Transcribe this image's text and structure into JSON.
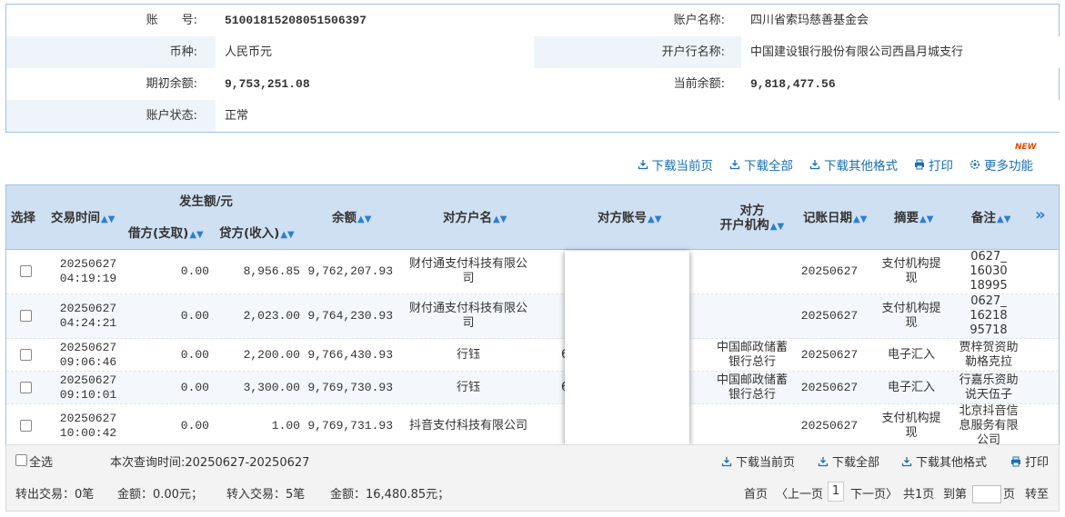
{
  "account": {
    "account_no_label": "账　　号:",
    "account_no": "51001815208051506397",
    "account_name_label": "账户名称:",
    "account_name": "四川省索玛慈善基金会",
    "currency_label": "币种:",
    "currency": "人民币元",
    "bank_label": "开户行名称:",
    "bank": "中国建设银行股份有限公司西昌月城支行",
    "opening_balance_label": "期初余额:",
    "opening_balance": "9,753,251.08",
    "current_balance_label": "当前余额:",
    "current_balance": "9,818,477.56",
    "status_label": "账户状态:",
    "status": "正常"
  },
  "toolbar": {
    "download_page": "下载当前页",
    "download_all": "下载全部",
    "download_other": "下载其他格式",
    "print": "打印",
    "more": "更多功能",
    "new_badge": "NEW"
  },
  "table": {
    "headers": {
      "select": "选择",
      "time": "交易时间",
      "amount_group": "发生额/元",
      "debit": "借方(支取)",
      "credit": "贷方(收入)",
      "balance": "余额",
      "counterparty_name": "对方户名",
      "counterparty_account": "对方账号",
      "counterparty_bank_1": "对方",
      "counterparty_bank_2": "开户机构",
      "post_date": "记账日期",
      "summary": "摘要",
      "remark": "备注",
      "more_cols": "»"
    },
    "rows": [
      {
        "date": "20250627",
        "time": "04:19:19",
        "debit": "0.00",
        "credit": "8,956.85",
        "balance": "9,762,207.93",
        "name_1": "财付通支付科技有限公",
        "name_2": "司",
        "acct": "",
        "bank_1": "",
        "bank_2": "",
        "post": "20250627",
        "summary_1": "支付机构提",
        "summary_2": "现",
        "remark_1": "0627_",
        "remark_2": "16030",
        "remark_3": "18995"
      },
      {
        "date": "20250627",
        "time": "04:24:21",
        "debit": "0.00",
        "credit": "2,023.00",
        "balance": "9,764,230.93",
        "name_1": "财付通支付科技有限公",
        "name_2": "司",
        "acct": "",
        "bank_1": "",
        "bank_2": "",
        "post": "20250627",
        "summary_1": "支付机构提",
        "summary_2": "现",
        "remark_1": "0627_",
        "remark_2": "16218",
        "remark_3": "95718"
      },
      {
        "date": "20250627",
        "time": "09:06:46",
        "debit": "0.00",
        "credit": "2,200.00",
        "balance": "9,766,430.93",
        "name_1": "行钰",
        "name_2": "",
        "acct": "6",
        "bank_1": "中国邮政储蓄",
        "bank_2": "银行总行",
        "post": "20250627",
        "summary_1": "电子汇入",
        "summary_2": "",
        "remark_1": "贾梓贺资助",
        "remark_2": "勒格克拉",
        "remark_3": ""
      },
      {
        "date": "20250627",
        "time": "09:10:01",
        "debit": "0.00",
        "credit": "3,300.00",
        "balance": "9,769,730.93",
        "name_1": "行钰",
        "name_2": "",
        "acct": "6",
        "bank_1": "中国邮政储蓄",
        "bank_2": "银行总行",
        "post": "20250627",
        "summary_1": "电子汇入",
        "summary_2": "",
        "remark_1": "行嘉乐资助",
        "remark_2": "说天伍子",
        "remark_3": ""
      },
      {
        "date": "20250627",
        "time": "10:00:42",
        "debit": "0.00",
        "credit": "1.00",
        "balance": "9,769,731.93",
        "name_1": "抖音支付科技有限公司",
        "name_2": "",
        "acct": "",
        "bank_1": "",
        "bank_2": "",
        "post": "20250627",
        "summary_1": "支付机构提",
        "summary_2": "现",
        "remark_1": "北京抖音信",
        "remark_2": "息服务有限",
        "remark_3": "公司"
      }
    ]
  },
  "footer": {
    "select_all": "全选",
    "query_time": "本次查询时间:20250627-20250627",
    "download_page": "下载当前页",
    "download_all": "下载全部",
    "download_other": "下载其他格式",
    "print": "打印",
    "out_summary": "转出交易：0笔",
    "out_amount": "金额：0.00元；",
    "in_summary": "转入交易：5笔",
    "in_amount": "金额：16,480.85元；",
    "first": "首页",
    "prev": "〈上一页",
    "page_num": "1",
    "next": "下一页〉",
    "total": "共1页",
    "goto": "到第",
    "page_unit": "页",
    "go": "转至"
  },
  "colors": {
    "link": "#1a6fb5",
    "header_bg": "#cfe0f2",
    "border": "#9cc3e6"
  },
  "icons": [
    "download-icon",
    "print-icon",
    "gear-icon",
    "sort-icon",
    "chevron-right-double-icon",
    "checkbox-icon"
  ]
}
